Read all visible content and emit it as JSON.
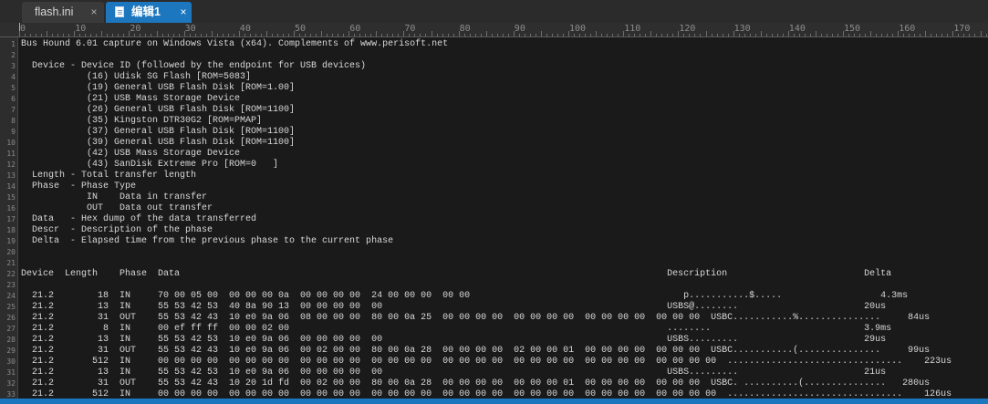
{
  "tabs": [
    {
      "label": "flash.ini",
      "close_glyph": "×"
    },
    {
      "label": "编辑1",
      "close_glyph": "×",
      "icon": "document-icon"
    }
  ],
  "ruler": {
    "numbers": [
      "0",
      "10",
      "20",
      "30",
      "40",
      "50",
      "60",
      "70",
      "80",
      "90",
      "100",
      "110",
      "120",
      "130",
      "140",
      "150",
      "160",
      "170"
    ]
  },
  "editor": {
    "lines": [
      {
        "n": "1",
        "text": "Bus Hound 6.01 capture on Windows Vista (x64). Complements of www.perisoft.net"
      },
      {
        "n": "2",
        "text": ""
      },
      {
        "n": "3",
        "text": "  Device - Device ID (followed by the endpoint for USB devices)"
      },
      {
        "n": "4",
        "text": "            (16) Udisk SG Flash [ROM=5083]"
      },
      {
        "n": "5",
        "text": "            (19) General USB Flash Disk [ROM=1.00]"
      },
      {
        "n": "6",
        "text": "            (21) USB Mass Storage Device"
      },
      {
        "n": "7",
        "text": "            (26) General USB Flash Disk [ROM=1100]"
      },
      {
        "n": "8",
        "text": "            (35) Kingston DTR30G2 [ROM=PMAP]"
      },
      {
        "n": "9",
        "text": "            (37) General USB Flash Disk [ROM=1100]"
      },
      {
        "n": "10",
        "text": "            (39) General USB Flash Disk [ROM=1100]"
      },
      {
        "n": "11",
        "text": "            (42) USB Mass Storage Device"
      },
      {
        "n": "12",
        "text": "            (43) SanDisk Extreme Pro [ROM=0   ]"
      },
      {
        "n": "13",
        "text": "  Length - Total transfer length"
      },
      {
        "n": "14",
        "text": "  Phase  - Phase Type"
      },
      {
        "n": "15",
        "text": "            IN    Data in transfer"
      },
      {
        "n": "16",
        "text": "            OUT   Data out transfer"
      },
      {
        "n": "17",
        "text": "  Data   - Hex dump of the data transferred"
      },
      {
        "n": "18",
        "text": "  Descr  - Description of the phase"
      },
      {
        "n": "19",
        "text": "  Delta  - Elapsed time from the previous phase to the current phase"
      },
      {
        "n": "20",
        "text": ""
      },
      {
        "n": "21",
        "text": ""
      },
      {
        "n": "22",
        "text": "Device  Length    Phase  Data                                                                                         Description                         Delta"
      },
      {
        "n": "23",
        "text": ""
      },
      {
        "n": "24",
        "text": "  21.2        18  IN     70 00 05 00  00 00 00 0a  00 00 00 00  24 00 00 00  00 00                                       p...........$.....                  4.3ms"
      },
      {
        "n": "25",
        "text": "  21.2        13  IN     55 53 42 53  40 8a 90 13  00 00 00 00  00                                                    USBS@........                       20us"
      },
      {
        "n": "26",
        "text": "  21.2        31  OUT    55 53 42 43  10 e0 9a 06  08 00 00 00  80 00 0a 25  00 00 00 00  00 00 00 00  00 00 00 00  00 00 00  USBC...........%...............     84us"
      },
      {
        "n": "27",
        "text": "  21.2         8  IN     00 ef ff ff  00 00 02 00                                                                     ........                            3.9ms"
      },
      {
        "n": "28",
        "text": "  21.2        13  IN     55 53 42 53  10 e0 9a 06  00 00 00 00  00                                                    USBS.........                       29us"
      },
      {
        "n": "29",
        "text": "  21.2        31  OUT    55 53 42 43  10 e0 9a 06  00 02 00 00  80 00 0a 28  00 00 00 00  02 00 00 01  00 00 00 00  00 00 00  USBC...........(...............     99us"
      },
      {
        "n": "30",
        "text": "  21.2       512  IN     00 00 00 00  00 00 00 00  00 00 00 00  00 00 00 00  00 00 00 00  00 00 00 00  00 00 00 00  00 00 00 00  ................................    223us"
      },
      {
        "n": "31",
        "text": "  21.2        13  IN     55 53 42 53  10 e0 9a 06  00 00 00 00  00                                                    USBS.........                       21us"
      },
      {
        "n": "32",
        "text": "  21.2        31  OUT    55 53 42 43  10 20 1d fd  00 02 00 00  80 00 0a 28  00 00 00 00  00 00 00 01  00 00 00 00  00 00 00  USBC. ..........(...............   280us"
      },
      {
        "n": "33",
        "text": "  21.2       512  IN     00 00 00 00  00 00 00 00  00 00 00 00  00 00 00 00  00 00 00 00  00 00 00 00  00 00 00 00  00 00 00 00  ................................    126us"
      }
    ]
  },
  "colors": {
    "accent": "#1d77bf",
    "editor_bg": "#1a1a1a",
    "text": "#d8d8d8",
    "gutter_text": "#8a8a8a"
  }
}
